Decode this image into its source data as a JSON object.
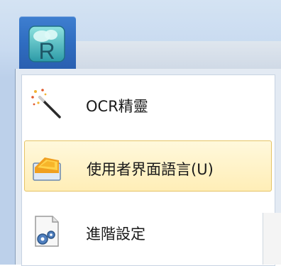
{
  "app_menu": {
    "logo_icon": "cloud-r-logo-icon",
    "logo_letter": "R",
    "items": [
      {
        "label": "OCR精靈",
        "icon": "magic-wand-icon",
        "highlighted": false
      },
      {
        "label": "使用者界面語言(U)",
        "icon": "language-folder-icon",
        "highlighted": true
      },
      {
        "label": "進階設定",
        "icon": "settings-document-icon",
        "highlighted": false
      }
    ]
  },
  "colors": {
    "app_button": "#2f6dc1",
    "highlight": "#ffeeb7",
    "highlight_border": "#e5c365"
  }
}
